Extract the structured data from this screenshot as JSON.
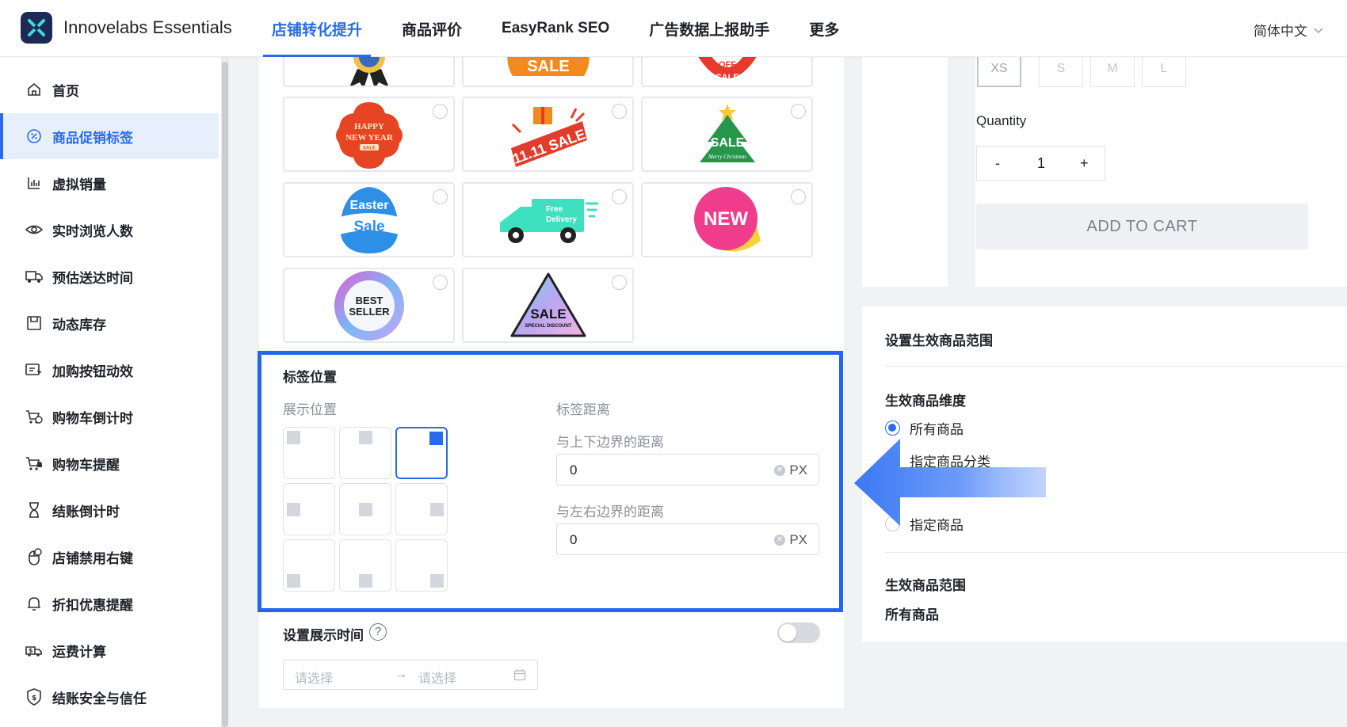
{
  "topbar": {
    "app_title": "Innovelabs Essentials",
    "nav": [
      "店铺转化提升",
      "商品评价",
      "EasyRank SEO",
      "广告数据上报助手",
      "更多"
    ],
    "active_nav_index": 0,
    "language": "简体中文"
  },
  "sidebar": {
    "items": [
      {
        "label": "首页",
        "icon": "home-icon"
      },
      {
        "label": "商品促销标签",
        "icon": "badge-percent-icon",
        "active": true
      },
      {
        "label": "虚拟销量",
        "icon": "bar-chart-icon"
      },
      {
        "label": "实时浏览人数",
        "icon": "eye-icon"
      },
      {
        "label": "预估送达时间",
        "icon": "truck-icon"
      },
      {
        "label": "动态库存",
        "icon": "inventory-icon"
      },
      {
        "label": "加购按钮动效",
        "icon": "cart-button-icon"
      },
      {
        "label": "购物车倒计时",
        "icon": "cart-timer-icon"
      },
      {
        "label": "购物车提醒",
        "icon": "cart-bell-icon"
      },
      {
        "label": "结账倒计时",
        "icon": "hourglass-icon"
      },
      {
        "label": "店铺禁用右键",
        "icon": "mouse-icon"
      },
      {
        "label": "折扣优惠提醒",
        "icon": "bell-icon"
      },
      {
        "label": "运费计算",
        "icon": "shipping-fee-icon"
      },
      {
        "label": "结账安全与信任",
        "icon": "shield-icon"
      }
    ]
  },
  "stickers": {
    "happy_new_year": {
      "line1": "HAPPY",
      "line2": "NEW YEAR",
      "line3": "SALE"
    },
    "sale_1111": "11.11 SALE",
    "christmas": {
      "main": "SALE",
      "sub": "Merry Christmas"
    },
    "easter": {
      "line1": "Easter",
      "line2": "Sale"
    },
    "free_delivery": {
      "line1": "Free",
      "line2": "Delivery"
    },
    "new": "NEW",
    "best_seller": {
      "line1": "BEST",
      "line2": "SELLER"
    },
    "sale_special": {
      "main": "SALE",
      "sub": "SPECIAL DISCOUNT"
    },
    "top_partial": {
      "sale": "SALE",
      "off": "OFF",
      "off_sale": "SALE"
    }
  },
  "label_position": {
    "title": "标签位置",
    "display_position_label": "展示位置",
    "selected_position": "top-right",
    "distance_label": "标签距离",
    "vertical_label": "与上下边界的距离",
    "vertical_value": "0",
    "horizontal_label": "与左右边界的距离",
    "horizontal_value": "0",
    "unit": "PX"
  },
  "display_time": {
    "title": "设置展示时间",
    "enabled": false,
    "start_placeholder": "请选择",
    "end_placeholder": "请选择",
    "separator": "→"
  },
  "product_preview": {
    "sizes": [
      "XS",
      "S",
      "M",
      "L"
    ],
    "selected_size": "XS",
    "quantity_label": "Quantity",
    "minus": "-",
    "quantity": "1",
    "plus": "+",
    "add_to_cart": "ADD TO CART"
  },
  "scope": {
    "title": "设置生效商品范围",
    "dimension_title": "生效商品维度",
    "options": [
      "所有商品",
      "指定商品分类",
      "指定商品"
    ],
    "selected_option": "所有商品",
    "range_title": "生效商品范围",
    "range_value": "所有商品"
  },
  "colors": {
    "accent": "#2a6be8",
    "highlight_border": "#2266ee",
    "arrow": "#3b78f5"
  }
}
